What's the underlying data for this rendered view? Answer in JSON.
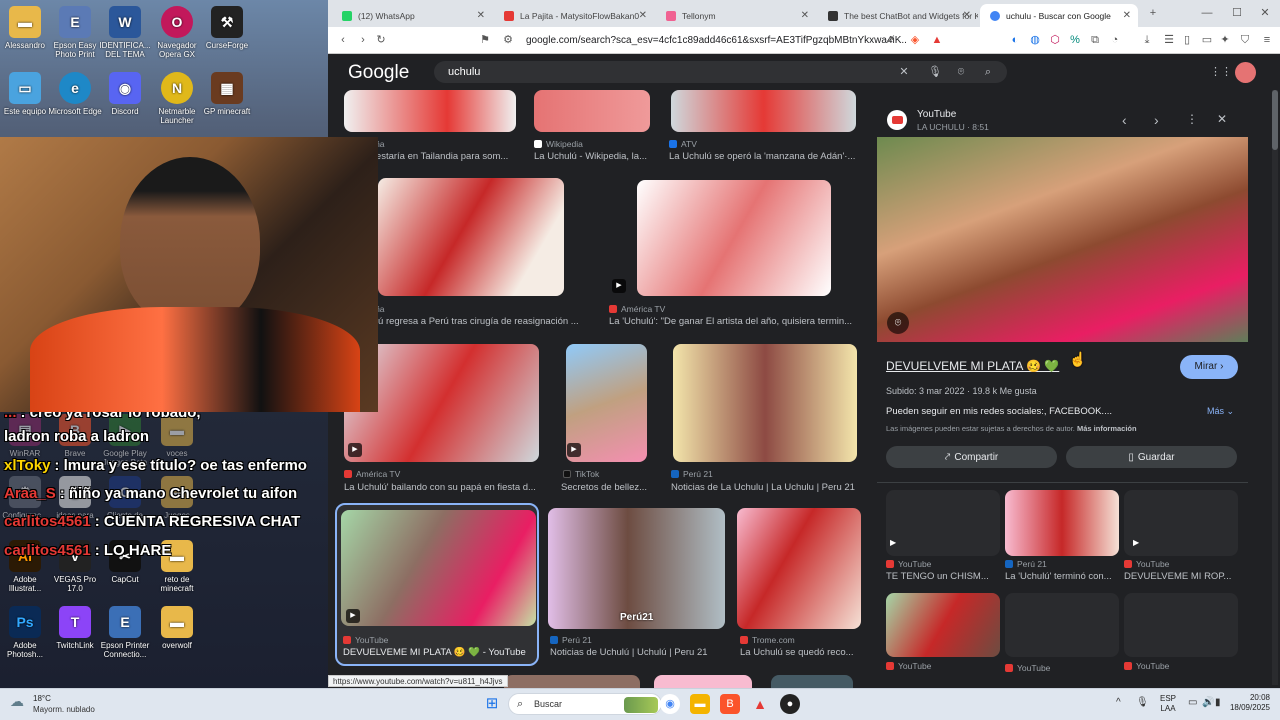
{
  "desktop": {
    "icons": [
      {
        "label": "Alessandro",
        "color": "#e8b84a",
        "glyph": "▬"
      },
      {
        "label": "Epson Easy Photo Print",
        "color": "#5b7ab5",
        "glyph": "E"
      },
      {
        "label": "IDENTIFICA... DEL TEMA",
        "color": "#2b579a",
        "glyph": "W"
      },
      {
        "label": "Navegador Opera GX",
        "color": "#c2185b",
        "glyph": "O"
      },
      {
        "label": "CurseForge",
        "color": "#222",
        "glyph": "⚒"
      },
      {
        "label": "Este equipo",
        "color": "#4aa3df",
        "glyph": "▭"
      },
      {
        "label": "Microsoft Edge",
        "color": "#1e88c7",
        "glyph": "e"
      },
      {
        "label": "Discord",
        "color": "#5865f2",
        "glyph": "◉"
      },
      {
        "label": "Netmarble Launcher",
        "color": "#e0b81a",
        "glyph": "N"
      },
      {
        "label": "GP minecraft",
        "color": "#6a3b20",
        "glyph": "▦"
      },
      {
        "label": "Adobe Illustrat...",
        "color": "#2b1a05",
        "glyph": "Ai"
      },
      {
        "label": "VEGAS Pro 17.0",
        "color": "#222",
        "glyph": "V"
      },
      {
        "label": "CapCut",
        "color": "#111",
        "glyph": "✂"
      },
      {
        "label": "reto de minecraft",
        "color": "#e8b84a",
        "glyph": "▬"
      },
      {
        "label": "Adobe Photosh...",
        "color": "#0a2a55",
        "glyph": "Ps"
      },
      {
        "label": "TwitchLink",
        "color": "#8c44f7",
        "glyph": "T"
      },
      {
        "label": "Epson Printer Connectio...",
        "color": "#3b6fb6",
        "glyph": "E"
      },
      {
        "label": "overwolf",
        "color": "#e8b84a",
        "glyph": "▬"
      }
    ],
    "bg_labels": [
      "WinRAR",
      "Brave",
      "Google Play Juegos Beta",
      "voces",
      "Configurac...",
      "ideas para",
      "Cliente de",
      "Juegos"
    ],
    "chat": [
      {
        "user": "...",
        "msg": ": creo ya rosar lo robado,"
      },
      {
        "user": "",
        "msg": "ladron roba a ladron"
      },
      {
        "user": "xlToky",
        "msg": ": lmura y ese título? oe tas enfermo"
      },
      {
        "user": "Araa_S",
        "msg": ": ñiño ya mano Chevrolet tu aifon"
      },
      {
        "user": "carlitos4561",
        "msg": ": CUENTA REGRESIVA CHAT"
      },
      {
        "user": "carlitos4561",
        "msg": ": LO HARE"
      }
    ]
  },
  "browser": {
    "tabs": [
      {
        "title": "(12) WhatsApp",
        "color": "#25d366"
      },
      {
        "title": "La Pajita - MatysitoFlowBakan0",
        "color": "#e53935"
      },
      {
        "title": "Tellonym",
        "color": "#f06292"
      },
      {
        "title": "The best ChatBot and Widgets for K",
        "color": "#333"
      },
      {
        "title": "uchulu - Buscar con Google",
        "color": "#4285f4"
      }
    ],
    "url": "google.com/search?sca_esv=4cfc1c89add46c61&sxsrf=AE3TifPgzqbMBtnYkxwa4iK...",
    "status_url": "https://www.youtube.com/watch?v=u811_h4Jjvs"
  },
  "google": {
    "logo": "Google",
    "query": "uchulu",
    "results": [
      {
        "source": "...ña",
        "caption": "...estaría en Tailandia para som...",
        "fav": "#888"
      },
      {
        "source": "Wikipedia",
        "caption": "La Uchulú - Wikipedia, la...",
        "fav": "#fff"
      },
      {
        "source": "ATV",
        "caption": "La Uchulú se operó la 'manzana de Adán'·...",
        "fav": "#1a73e8"
      },
      {
        "source": "...ña",
        "caption": "...lú regresa a Perú tras cirugía de reasignación ...",
        "fav": "#888"
      },
      {
        "source": "América TV",
        "caption": "La 'Uchulú': \"De ganar El artista del año, quisiera termin...",
        "fav": "#e53935"
      },
      {
        "source": "América TV",
        "caption": "La Uchulú' bailando con su papá en fiesta d...",
        "fav": "#e53935"
      },
      {
        "source": "TikTok",
        "caption": "Secretos de bellez...",
        "fav": "#111"
      },
      {
        "source": "Perú 21",
        "caption": "Noticias de La Uchulu | La Uchulu | Peru 21",
        "fav": "#1565c0"
      },
      {
        "source": "YouTube",
        "caption": "DEVUELVEME MI PLATA 🥴 💚 - YouTube",
        "fav": "#e53935"
      },
      {
        "source": "Perú 21",
        "caption": "Noticias de Uchulú | Uchulú | Peru 21",
        "fav": "#1565c0"
      },
      {
        "source": "Trome.com",
        "caption": "La Uchulú se quedó reco...",
        "fav": "#e53935"
      }
    ],
    "badge_peru21": "Perú21",
    "panel": {
      "site": "YouTube",
      "channel": "LA UCHULU · 8:51",
      "title": "DEVUELVEME MI PLATA 🥴 💚",
      "watch": "Mirar",
      "meta": "Subido: 3 mar 2022 · 19.8 k Me gusta",
      "desc": "Pueden seguir en mis redes sociales:, FACEBOOK....",
      "more": "Más",
      "rights": "Las imágenes pueden estar sujetas a derechos de autor.",
      "more_info": "Más información",
      "share": "Compartir",
      "save": "Guardar",
      "related": [
        {
          "source": "YouTube",
          "caption": "TE TENGO un CHISM..."
        },
        {
          "source": "Perú 21",
          "caption": "La 'Uchulú' terminó con..."
        },
        {
          "source": "YouTube",
          "caption": "DEVUELVEME MI ROP..."
        },
        {
          "source": "YouTube",
          "caption": ""
        },
        {
          "source": "YouTube",
          "caption": ""
        },
        {
          "source": "YouTube",
          "caption": ""
        }
      ]
    }
  },
  "taskbar": {
    "weather_temp": "18°C",
    "weather_desc": "Mayorm. nublado",
    "search": "Buscar",
    "lang1": "ESP",
    "lang2": "LAA",
    "time": "20:08",
    "date": "18/09/2025"
  },
  "colors": {
    "accent": "#8ab4f8",
    "panel_btn": "#8ab4f8"
  }
}
